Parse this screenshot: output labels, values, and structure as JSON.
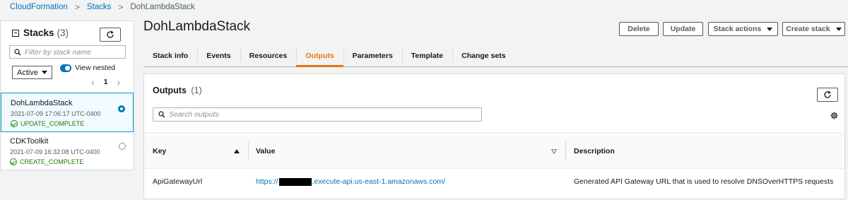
{
  "breadcrumb": {
    "items": [
      "CloudFormation",
      "Stacks"
    ],
    "current": "DohLambdaStack"
  },
  "sidebar": {
    "title": "Stacks",
    "count": "(3)",
    "filter_placeholder": "Filter by stack name",
    "status_filter": "Active",
    "view_nested_label": "View nested",
    "page": "1",
    "stacks": [
      {
        "name": "DohLambdaStack",
        "date": "2021-07-09 17:06:17 UTC-0400",
        "status": "UPDATE_COMPLETE",
        "selected": true
      },
      {
        "name": "CDKToolkit",
        "date": "2021-07-09 16:32:08 UTC-0400",
        "status": "CREATE_COMPLETE",
        "selected": false
      }
    ]
  },
  "header": {
    "title": "DohLambdaStack",
    "buttons": {
      "delete": "Delete",
      "update": "Update",
      "stack_actions": "Stack actions",
      "create_stack": "Create stack"
    }
  },
  "tabs": [
    {
      "label": "Stack info",
      "active": false
    },
    {
      "label": "Events",
      "active": false
    },
    {
      "label": "Resources",
      "active": false
    },
    {
      "label": "Outputs",
      "active": true
    },
    {
      "label": "Parameters",
      "active": false
    },
    {
      "label": "Template",
      "active": false
    },
    {
      "label": "Change sets",
      "active": false
    }
  ],
  "outputs": {
    "title": "Outputs",
    "count": "(1)",
    "search_placeholder": "Search outputs",
    "columns": {
      "key": "Key",
      "value": "Value",
      "description": "Description"
    },
    "rows": [
      {
        "key": "ApiGatewayUrl",
        "value_prefix": "https://",
        "value_suffix": ".execute-api.us-east-1.amazonaws.com/",
        "description": "Generated API Gateway URL that is used to resolve DNSOverHTTPS requests"
      }
    ]
  },
  "colors": {
    "link": "#0073bb",
    "active_tab": "#ec7211",
    "success": "#1d8102",
    "selected_bg": "#f1faff",
    "selected_border": "#00a1c9"
  }
}
